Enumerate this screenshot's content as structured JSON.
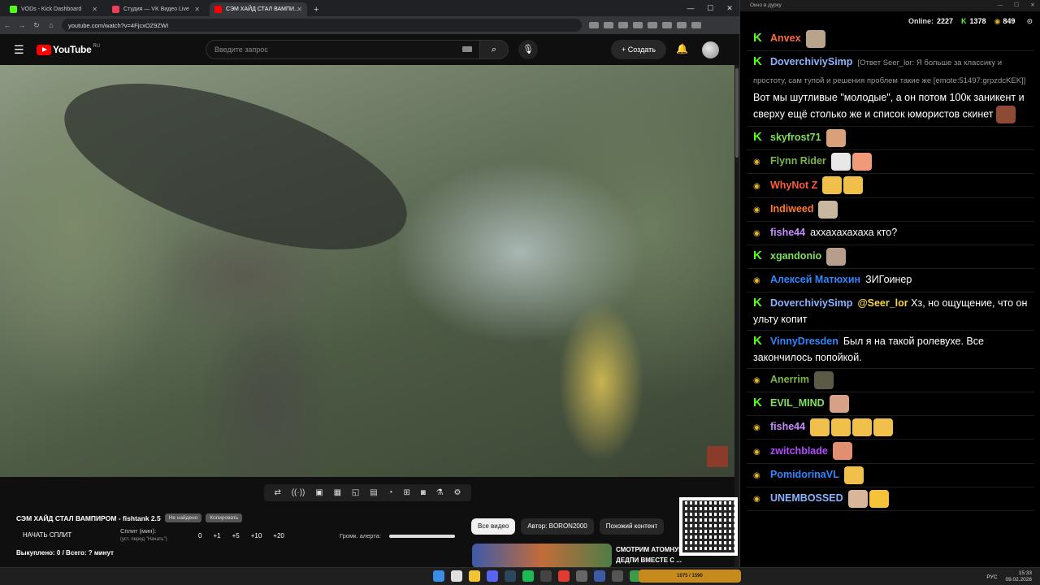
{
  "browser": {
    "tabs": [
      {
        "label": "VODs - Kick Dashboard",
        "fav_color": "#53fc18"
      },
      {
        "label": "Студия — VK Видео Live",
        "fav_color": "#e94057"
      },
      {
        "label": "СЭМ ХАЙД СТАЛ ВАМПИ...",
        "fav_color": "#ff0000",
        "active": true
      }
    ],
    "url": "youtube.com/watch?v=4FjcxOZ9ZWI"
  },
  "youtube": {
    "logo_text": "YouTube",
    "region": "RU",
    "search_placeholder": "Введите запрос",
    "create_label": "+ Создать",
    "video_title": "СЭМ ХАЙД СТАЛ ВАМПИРОМ - fishtank 2.5",
    "pill_not_found": "Не найдено",
    "pill_copy": "Копировать",
    "split_button": "НАЧАТЬ СПЛИТ",
    "split_label": "Сплит (мин):",
    "split_sub": "(уст. перед \"Начать\")",
    "split_values": [
      "0",
      "+1",
      "+5",
      "+10",
      "+20"
    ],
    "alert_volume_label": "Громк. алерта:",
    "alert_volume_level": 1.0,
    "bought": "Выкуплено: 0 / Всего: ? минут",
    "chips": [
      "Все видео",
      "Автор: BORON2000",
      "Похожий контент"
    ],
    "rec_title": "СМОТРИМ АТОМНУЮ БОМБУ ДЕДПИ ВМЕСТЕ С ..."
  },
  "chat": {
    "window_title": "Окно в дурку",
    "online_label": "Online:",
    "online_count": "2227",
    "kick_count": "1378",
    "vk_count": "849",
    "messages": [
      {
        "platform": "k",
        "name": "Anvex",
        "color": "#ff6a3d",
        "text": "",
        "reply": "",
        "emotes": [
          "#b9a38c"
        ]
      },
      {
        "platform": "k",
        "name": "DoverchiviySimp",
        "color": "#8ab4ff",
        "reply": "[Ответ Seer_lor: Я больше за классику и простоту, сам тупой и решения проблем такие же [emote:51497:grpzdcKEK]]",
        "text": "Вот мы шутливые \"молодые\", а он потом 100к заникент и сверху ещё столько же и список юмористов скинет",
        "emotes": [
          "#8d4b36"
        ]
      },
      {
        "platform": "k",
        "name": "skyfrost71",
        "color": "#7ee05a",
        "text": "",
        "reply": "",
        "emotes": [
          "#d9a07a"
        ]
      },
      {
        "platform": "c",
        "name": "Flynn Rider",
        "color": "#7ab648",
        "text": "",
        "reply": "",
        "emotes": [
          "#e8e8e8",
          "#f09a7a"
        ]
      },
      {
        "platform": "c",
        "name": "WhyNot Z",
        "color": "#ff5a36",
        "text": "",
        "reply": "",
        "emotes": [
          "#f0c04a",
          "#f0c04a"
        ]
      },
      {
        "platform": "c",
        "name": "Indiweed",
        "color": "#ff7a30",
        "text": "",
        "reply": "",
        "emotes": [
          "#c9b7a0"
        ]
      },
      {
        "platform": "c",
        "name": "fishe44",
        "color": "#c78cff",
        "text": "аххахахахаха кто?",
        "reply": "",
        "emotes": []
      },
      {
        "platform": "k",
        "name": "xgandonio",
        "color": "#7ee05a",
        "text": "",
        "reply": "",
        "emotes": [
          "#b89c8c"
        ]
      },
      {
        "platform": "c",
        "name": "Алексей Матюхин",
        "color": "#2f86ff",
        "text": "ЗИГоинер",
        "reply": "",
        "emotes": []
      },
      {
        "platform": "k",
        "name": "DoverchiviySimp",
        "color": "#8ab4ff",
        "mention": "@Seer_lor",
        "text": "Хз, но ощущение, что он ульту копит",
        "reply": "",
        "emotes": []
      },
      {
        "platform": "k",
        "name": "VinnyDresden",
        "color": "#2f86ff",
        "text": "Был я на такой ролевухе. Все закончилось попойкой.",
        "reply": "",
        "emotes": []
      },
      {
        "platform": "c",
        "name": "Anerrim",
        "color": "#7ab648",
        "text": "",
        "reply": "",
        "emotes": [
          "#5a5a46"
        ]
      },
      {
        "platform": "k",
        "name": "EVIL_MIND",
        "color": "#7ee05a",
        "text": "",
        "reply": "",
        "emotes": [
          "#d7a088"
        ]
      },
      {
        "platform": "c",
        "name": "fishe44",
        "color": "#c78cff",
        "text": "",
        "reply": "",
        "emotes": [
          "#f0c04a",
          "#f0c04a",
          "#f0c04a",
          "#f0c04a"
        ]
      },
      {
        "platform": "c",
        "name": "zwitchblade",
        "color": "#b44bff",
        "text": "",
        "reply": "",
        "emotes": [
          "#e09070"
        ]
      },
      {
        "platform": "c",
        "name": "PomidorinaVL",
        "color": "#2f86ff",
        "text": "",
        "reply": "",
        "emotes": [
          "#f0c04a"
        ]
      },
      {
        "platform": "c",
        "name": "UNEMBOSSED",
        "color": "#8ab4ff",
        "text": "",
        "reply": "",
        "emotes": [
          "#d9b59a",
          "#f5c23a"
        ]
      }
    ]
  },
  "taskbar": {
    "app_label": "1075 / 1590",
    "lang": "РУС",
    "time": "15:33",
    "date": "09.02.2026"
  }
}
